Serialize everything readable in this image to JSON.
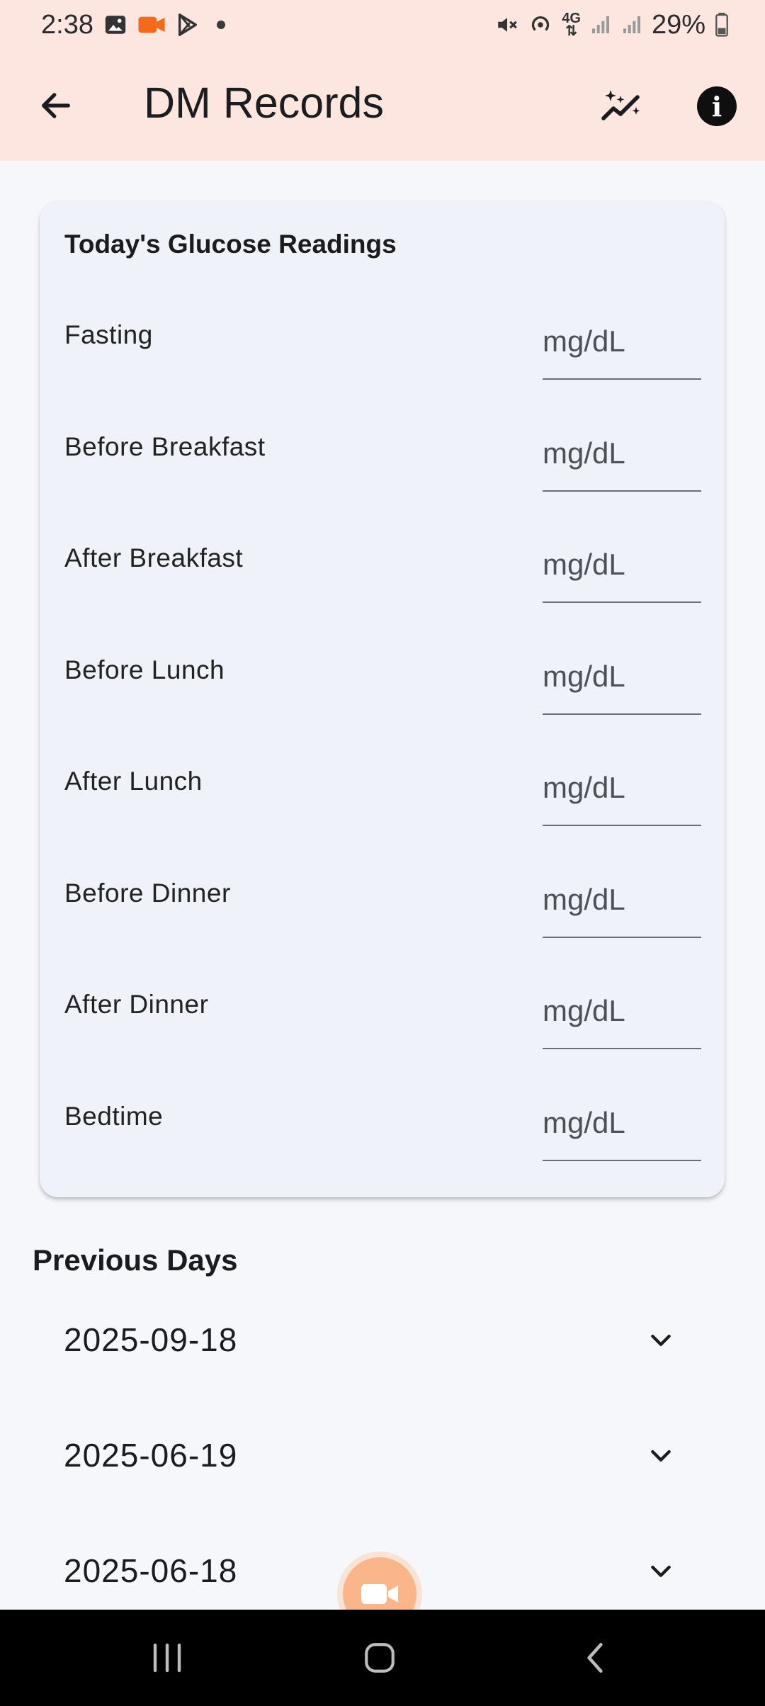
{
  "status_bar": {
    "time": "2:38",
    "battery": "29%",
    "network": "4G",
    "icons": [
      "gallery-icon",
      "video-record-icon",
      "play-store-icon",
      "dot-icon",
      "mute-icon",
      "hotspot-icon",
      "network-4g-icon",
      "signal-icon",
      "signal-icon",
      "battery-icon"
    ]
  },
  "app_bar": {
    "title": "DM Records",
    "back_icon": "arrow-left-icon",
    "ai_icon": "sparkle-chart-icon",
    "info_icon": "info-icon",
    "info_glyph": "i",
    "background": "#fce6df"
  },
  "today": {
    "title": "Today's Glucose Readings",
    "readings": [
      {
        "label": "Fasting",
        "value": "",
        "placeholder": "mg/dL"
      },
      {
        "label": "Before Breakfast",
        "value": "",
        "placeholder": "mg/dL"
      },
      {
        "label": "After Breakfast",
        "value": "",
        "placeholder": "mg/dL"
      },
      {
        "label": "Before Lunch",
        "value": "",
        "placeholder": "mg/dL"
      },
      {
        "label": "After Lunch",
        "value": "",
        "placeholder": "mg/dL"
      },
      {
        "label": "Before Dinner",
        "value": "",
        "placeholder": "mg/dL"
      },
      {
        "label": "After Dinner",
        "value": "",
        "placeholder": "mg/dL"
      },
      {
        "label": "Bedtime",
        "value": "",
        "placeholder": "mg/dL"
      }
    ]
  },
  "previous": {
    "title": "Previous Days",
    "days": [
      {
        "date": "2025-09-18"
      },
      {
        "date": "2025-06-19"
      },
      {
        "date": "2025-06-18"
      }
    ]
  },
  "fab": {
    "icon": "video-camera-icon",
    "color": "#fbb58b"
  },
  "nav_bar": {
    "icons": [
      "recents-icon",
      "home-icon",
      "back-icon"
    ]
  }
}
